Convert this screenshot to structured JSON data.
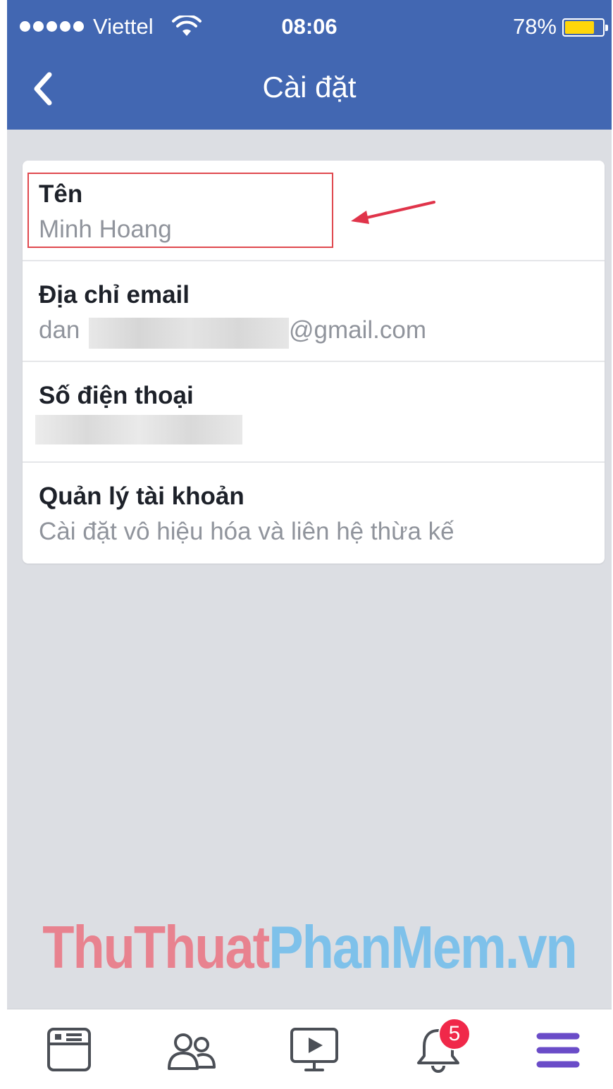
{
  "status_bar": {
    "carrier": "Viettel",
    "time": "08:06",
    "battery_percent": "78%",
    "battery_level": 0.78
  },
  "header": {
    "title": "Cài đặt",
    "back_icon": "chevron-left-icon"
  },
  "settings": {
    "name": {
      "label": "Tên",
      "value": "Minh Hoang"
    },
    "email": {
      "label": "Địa chỉ email",
      "value_prefix": "dan",
      "value_suffix": "@gmail.com"
    },
    "phone": {
      "label": "Số điện thoại"
    },
    "account": {
      "label": "Quản lý tài khoản",
      "value": "Cài đặt vô hiệu hóa và liên hệ thừa kế"
    }
  },
  "watermark": {
    "part1": "ThuThuat",
    "part2": "PhanMem.vn"
  },
  "tabbar": {
    "items": [
      {
        "icon": "news-feed-icon"
      },
      {
        "icon": "friends-icon"
      },
      {
        "icon": "video-icon"
      },
      {
        "icon": "notifications-icon",
        "badge": "5"
      },
      {
        "icon": "menu-icon"
      }
    ]
  },
  "colors": {
    "header": "#4267b2",
    "background": "#dcdee3",
    "highlight": "#e0494f",
    "menu_active": "#6a4cc8",
    "badge": "#f02849"
  }
}
